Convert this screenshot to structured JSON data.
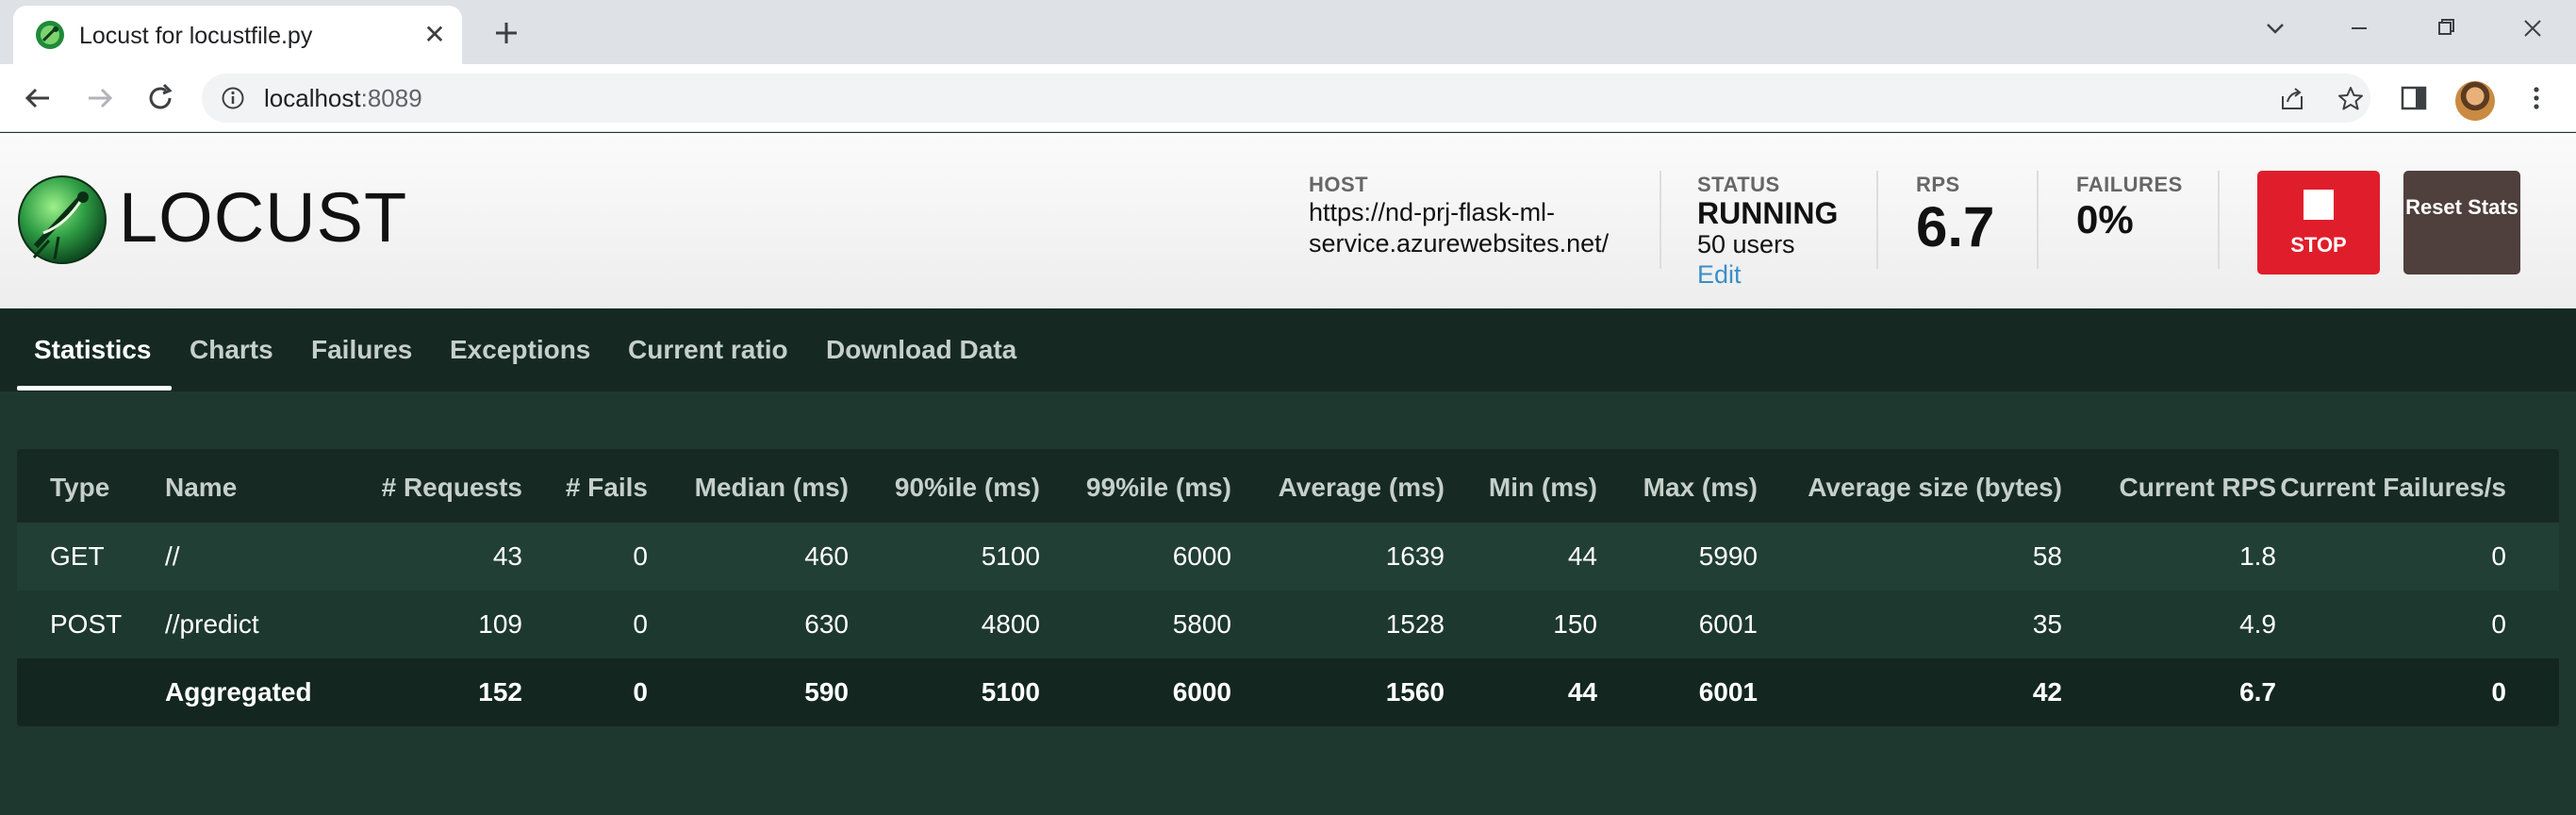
{
  "browser": {
    "tab_title": "Locust for locustfile.py",
    "url_host": "localhost",
    "url_port": ":8089"
  },
  "header": {
    "logo_text": "LOCUST",
    "host_label": "HOST",
    "host_value": "https://nd-prj-flask-ml-service.azurewebsites.net/",
    "status_label": "STATUS",
    "status_value": "RUNNING",
    "users_text": "50 users",
    "edit_label": "Edit",
    "rps_label": "RPS",
    "rps_value": "6.7",
    "failures_label": "FAILURES",
    "failures_value": "0%",
    "stop_label": "STOP",
    "reset_label": "Reset Stats",
    "colors": {
      "stop": "#e01e2b",
      "reset": "#4f403d",
      "edit_link": "#3a8fc8"
    }
  },
  "tabs": [
    {
      "label": "Statistics",
      "active": true
    },
    {
      "label": "Charts",
      "active": false
    },
    {
      "label": "Failures",
      "active": false
    },
    {
      "label": "Exceptions",
      "active": false
    },
    {
      "label": "Current ratio",
      "active": false
    },
    {
      "label": "Download Data",
      "active": false
    }
  ],
  "table": {
    "columns": [
      "Type",
      "Name",
      "# Requests",
      "# Fails",
      "Median (ms)",
      "90%ile (ms)",
      "99%ile (ms)",
      "Average (ms)",
      "Min (ms)",
      "Max (ms)",
      "Average size (bytes)",
      "Current RPS",
      "Current Failures/s"
    ],
    "rows": [
      [
        "GET",
        "//",
        "43",
        "0",
        "460",
        "5100",
        "6000",
        "1639",
        "44",
        "5990",
        "58",
        "1.8",
        "0"
      ],
      [
        "POST",
        "//predict",
        "109",
        "0",
        "630",
        "4800",
        "5800",
        "1528",
        "150",
        "6001",
        "35",
        "4.9",
        "0"
      ],
      [
        "",
        "Aggregated",
        "152",
        "0",
        "590",
        "5100",
        "6000",
        "1560",
        "44",
        "6001",
        "42",
        "6.7",
        "0"
      ]
    ]
  }
}
